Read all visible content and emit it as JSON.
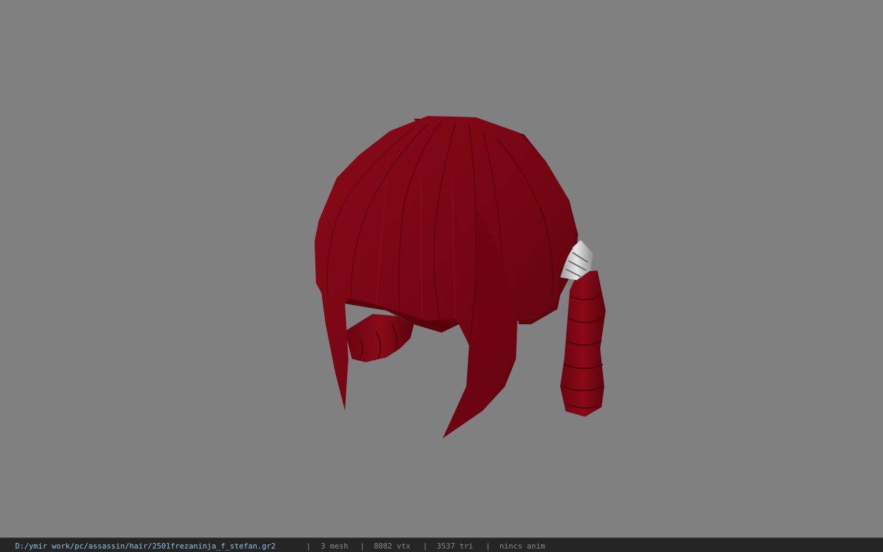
{
  "viewer": {
    "background_color": "#808080",
    "model": {
      "icon": "hair-mesh",
      "hair_color": "#7a0612",
      "band_color": "#c8c8c8"
    }
  },
  "status_bar": {
    "file_path": "D:/ymir work/pc/assassin/hair/2501frezaninja_f_stefan.gr2",
    "separator": "|",
    "mesh_count": "3 mesh",
    "vertex_count": "8082 vtx",
    "triangle_count": "3537 tri",
    "anim_status": "nincs anim"
  }
}
